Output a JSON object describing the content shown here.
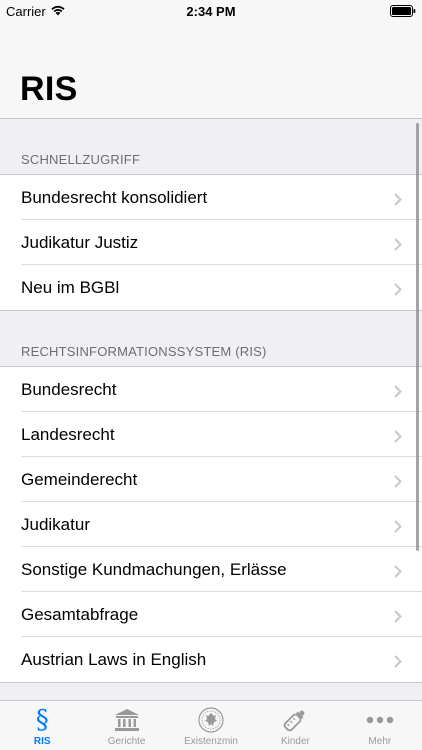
{
  "status": {
    "carrier": "Carrier",
    "time": "2:34 PM"
  },
  "nav": {
    "title": "RIS"
  },
  "sections": [
    {
      "header": "SCHNELLZUGRIFF",
      "items": [
        "Bundesrecht konsolidiert",
        "Judikatur Justiz",
        "Neu im BGBl"
      ]
    },
    {
      "header": "RECHTSINFORMATIONSSYSTEM (RIS)",
      "items": [
        "Bundesrecht",
        "Landesrecht",
        "Gemeinderecht",
        "Judikatur",
        "Sonstige Kundmachungen, Erlässe",
        "Gesamtabfrage",
        "Austrian Laws in English"
      ]
    }
  ],
  "tabs": [
    {
      "label": "RIS",
      "icon": "paragraph-icon",
      "active": true
    },
    {
      "label": "Gerichte",
      "icon": "courthouse-icon",
      "active": false
    },
    {
      "label": "Existenzmin",
      "icon": "seal-icon",
      "active": false
    },
    {
      "label": "Kinder",
      "icon": "baby-bottle-icon",
      "active": false
    },
    {
      "label": "Mehr",
      "icon": "more-icon",
      "active": false
    }
  ],
  "colors": {
    "accent": "#007aff",
    "inactive": "#999999",
    "background": "#efeff4"
  }
}
